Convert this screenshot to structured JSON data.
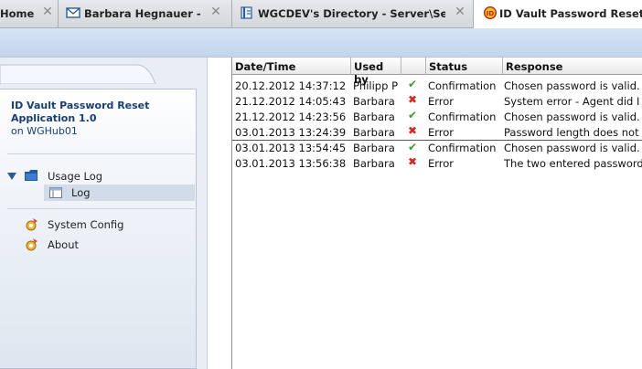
{
  "tabs": [
    {
      "label": "Home",
      "icon": "none",
      "active": false
    },
    {
      "label": "Barbara Hegnauer - Mail",
      "icon": "mail-icon",
      "active": false
    },
    {
      "label": "WGCDEV's Directory - Server\\Servers",
      "icon": "directory-icon",
      "active": false
    },
    {
      "label": "ID Vault Password Reset Appli",
      "icon": "app-icon",
      "active": true
    }
  ],
  "sidebar": {
    "app_title_line1": "ID Vault Password Reset",
    "app_title_line2": "Application 1.0",
    "app_subtitle": "on WGHub01",
    "usage_log": "Usage Log",
    "log": "Log",
    "system_config": "System Config",
    "about": "About"
  },
  "table": {
    "columns": [
      "Date/Time",
      "Used by",
      "",
      "Status",
      "Response"
    ],
    "rows": [
      {
        "datetime": "20.12.2012 14:37:12",
        "user": "Philipp P",
        "status_icon": "check-icon",
        "status": "Confirmation",
        "response": "Chosen password is valid."
      },
      {
        "datetime": "21.12.2012 14:05:43",
        "user": "Barbara",
        "status_icon": "cross-icon",
        "status": "Error",
        "response": "System error - Agent did I"
      },
      {
        "datetime": "21.12.2012 14:23:56",
        "user": "Barbara",
        "status_icon": "check-icon",
        "status": "Confirmation",
        "response": "Chosen password is valid."
      },
      {
        "datetime": "03.01.2013 13:24:39",
        "user": "Barbara",
        "status_icon": "cross-icon",
        "status": "Error",
        "response": "Password length does not"
      },
      {
        "datetime": "03.01.2013 13:54:45",
        "user": "Barbara",
        "status_icon": "check-icon",
        "status": "Confirmation",
        "response": "Chosen password is valid."
      },
      {
        "datetime": "03.01.2013 13:56:38",
        "user": "Barbara",
        "status_icon": "cross-icon",
        "status": "Error",
        "response": "The two entered password"
      }
    ]
  },
  "colors": {
    "header_band": "#c9d9ef",
    "check": "#3aa02a",
    "cross": "#d62b1b",
    "nav_text": "#173d7a"
  }
}
